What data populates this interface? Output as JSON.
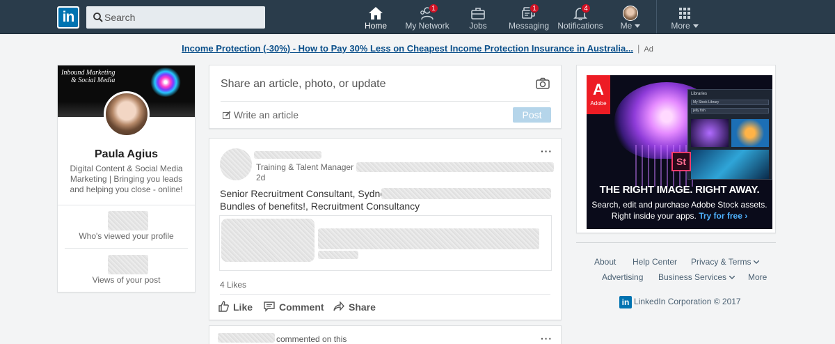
{
  "nav": {
    "search_placeholder": "Search",
    "items": [
      {
        "label": "Home",
        "badge": ""
      },
      {
        "label": "My Network",
        "badge": "1"
      },
      {
        "label": "Jobs",
        "badge": ""
      },
      {
        "label": "Messaging",
        "badge": "1"
      },
      {
        "label": "Notifications",
        "badge": "4"
      },
      {
        "label": "Me",
        "badge": ""
      },
      {
        "label": "More",
        "badge": ""
      }
    ],
    "brand_color": "#0073b1",
    "bar_color": "#2a3c4b"
  },
  "ad_banner": {
    "link_text": "Income Protection (-30%) - How to Pay 30% Less on Cheapest Income Protection Insurance in Australia...",
    "separator": "|",
    "ad_label": "Ad"
  },
  "profile": {
    "cover_text_1": "Inbound Marketing",
    "cover_text_2": "& Social Media",
    "name": "Paula Agius",
    "headline": "Digital Content & Social Media Marketing | Bringing you leads and helping you close - online!",
    "stats": [
      {
        "label": "Who's viewed your profile"
      },
      {
        "label": "Views of your post"
      }
    ]
  },
  "share": {
    "prompt": "Share an article, photo, or update",
    "write_article": "Write an article",
    "post_button": "Post"
  },
  "feed": {
    "post": {
      "subtitle": "Training & Talent Manager at",
      "time": "2d",
      "body_line1": "Senior Recruitment Consultant, Sydney,",
      "body_line2": "Bundles of benefits!, Recruitment Consultancy",
      "likes": "4 Likes",
      "actions": {
        "like": "Like",
        "comment": "Comment",
        "share": "Share"
      },
      "more": "···"
    },
    "next_post": {
      "commented": "commented on this",
      "more": "···"
    }
  },
  "right_ad": {
    "brand": "Adobe",
    "panel_title": "Libraries",
    "panel_library": "My Stock Library",
    "panel_search": "jelly fish",
    "product_badge": "St",
    "headline": "THE RIGHT IMAGE. RIGHT AWAY.",
    "subline": "Search, edit and purchase Adobe Stock assets.",
    "subline2": "Right inside your apps.",
    "cta": "Try for free ›"
  },
  "footer": {
    "links_row1": [
      "About",
      "Help Center",
      "Privacy & Terms"
    ],
    "links_row2": [
      "Advertising",
      "Business Services",
      "More"
    ],
    "logo": "in",
    "corporation": "LinkedIn Corporation © 2017"
  }
}
